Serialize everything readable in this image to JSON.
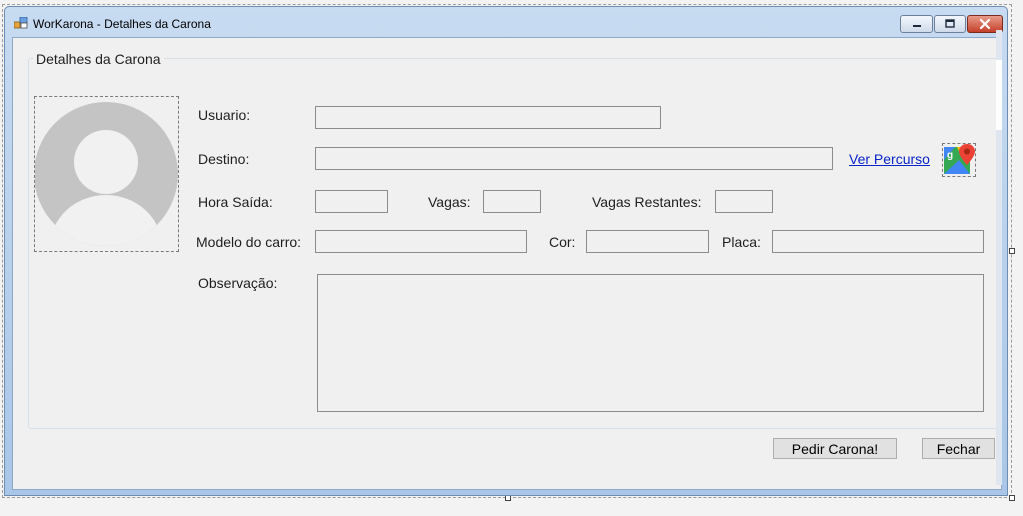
{
  "window": {
    "title": "WorKarona - Detalhes da Carona",
    "icon": "winforms-app-icon",
    "controls": {
      "minimize": "minimize-icon",
      "maximize": "maximize-icon",
      "close": "close-icon"
    }
  },
  "group": {
    "title": "Detalhes da Carona"
  },
  "avatar": {
    "icon": "user-avatar-placeholder-icon"
  },
  "fields": {
    "usuario": {
      "label": "Usuario:",
      "value": ""
    },
    "destino": {
      "label": "Destino:",
      "value": ""
    },
    "hora_saida": {
      "label": "Hora Saída:",
      "value": ""
    },
    "vagas": {
      "label": "Vagas:",
      "value": ""
    },
    "vagas_restantes": {
      "label": "Vagas Restantes:",
      "value": ""
    },
    "modelo_carro": {
      "label": "Modelo do carro:",
      "value": ""
    },
    "cor": {
      "label": "Cor:",
      "value": ""
    },
    "placa": {
      "label": "Placa:",
      "value": ""
    },
    "observacao": {
      "label": "Observação:",
      "value": ""
    }
  },
  "ver_percurso": {
    "label": "Ver Percurso",
    "icon": "google-maps-icon"
  },
  "buttons": {
    "pedir": "Pedir Carona!",
    "fechar": "Fechar"
  },
  "colors": {
    "link": "#0a24c9",
    "title_bar": "#b9d1ea",
    "close_button": "#c4402a"
  }
}
